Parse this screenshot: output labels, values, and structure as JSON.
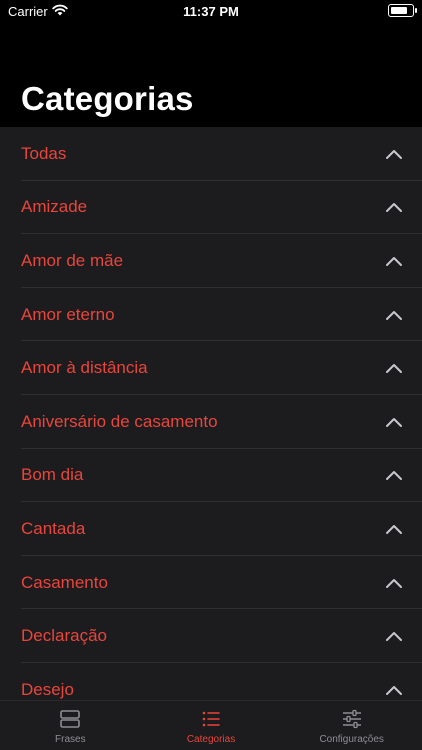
{
  "status_bar": {
    "carrier": "Carrier",
    "time": "11:37 PM"
  },
  "header": {
    "title": "Categorias"
  },
  "categories": [
    {
      "label": "Todas"
    },
    {
      "label": "Amizade"
    },
    {
      "label": "Amor de mãe"
    },
    {
      "label": "Amor eterno"
    },
    {
      "label": "Amor à distância"
    },
    {
      "label": "Aniversário de casamento"
    },
    {
      "label": "Bom dia"
    },
    {
      "label": "Cantada"
    },
    {
      "label": "Casamento"
    },
    {
      "label": "Declaração"
    },
    {
      "label": "Desejo"
    }
  ],
  "tabbar": {
    "items": [
      {
        "label": "Frases",
        "icon": "frases-icon",
        "active": false
      },
      {
        "label": "Categorias",
        "icon": "list-icon",
        "active": true
      },
      {
        "label": "Configurações",
        "icon": "sliders-icon",
        "active": false
      }
    ]
  },
  "colors": {
    "accent": "#e8453c",
    "inactive": "#8e8e93",
    "list_bg": "#1c1c1e",
    "header_bg": "#000000"
  }
}
